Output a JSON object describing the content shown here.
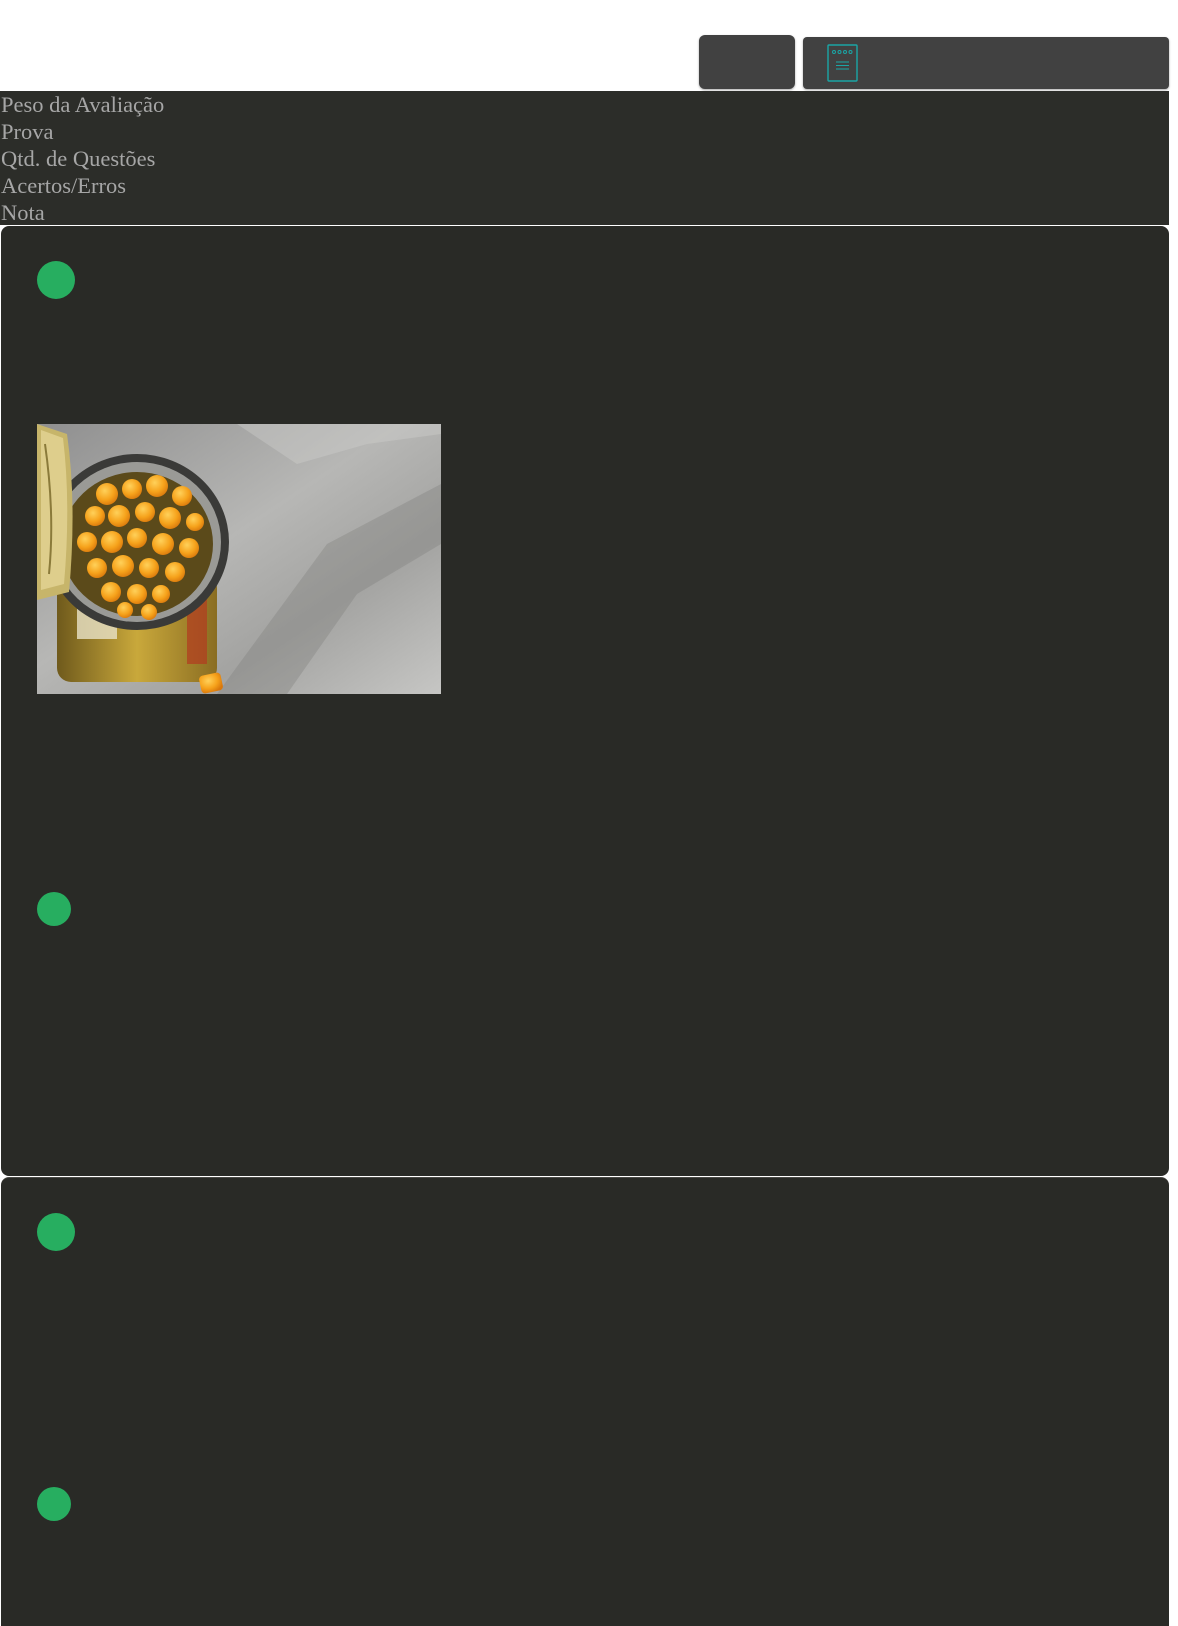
{
  "header": {
    "menu_button_label": "",
    "document_icon": "document-icon"
  },
  "info": {
    "labels": [
      "Peso da Avaliação",
      "Prova",
      "Qtd. de Questões",
      "Acertos/Erros",
      "Nota"
    ]
  },
  "questions": [
    {
      "status_color": "#27ae60",
      "image": "canned-corn-photo",
      "answer_status_color": "#27ae60"
    },
    {
      "status_color": "#27ae60",
      "answer_status_color": "#27ae60"
    }
  ],
  "colors": {
    "accent": "#27ae60",
    "icon": "#1aa6a6",
    "panel": "#414141",
    "card": "#292a26",
    "info_bg": "#2c2d29",
    "info_text": "#a6a6a6"
  }
}
